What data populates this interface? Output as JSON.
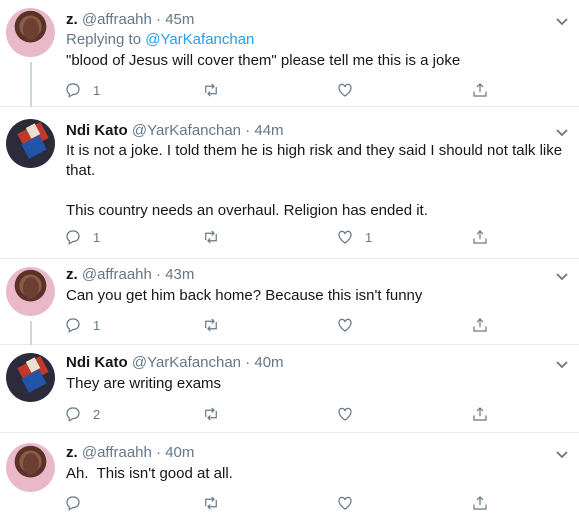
{
  "tweets": [
    {
      "name": "z.",
      "handle": "@affraahh",
      "dot": "·",
      "time": "45m",
      "replying_prefix": "Replying to",
      "replying_to": "@YarKafanchan",
      "text": [
        "\"blood of Jesus will cover them\" please tell me this is a joke"
      ],
      "replies": "1",
      "retweets": "",
      "likes": "",
      "avatar_icon": "profile-photo-z"
    },
    {
      "name": "Ndi Kato",
      "handle": "@YarKafanchan",
      "dot": "·",
      "time": "44m",
      "text": [
        "It is not a joke. I told them he is high risk and they said I should not talk like that.",
        "This country needs an overhaul. Religion has ended it."
      ],
      "replies": "1",
      "retweets": "",
      "likes": "1",
      "avatar_icon": "profile-photo-ndi-kato"
    },
    {
      "name": "z.",
      "handle": "@affraahh",
      "dot": "·",
      "time": "43m",
      "text": [
        "Can you get him back home? Because this isn't funny"
      ],
      "replies": "1",
      "retweets": "",
      "likes": "",
      "avatar_icon": "profile-photo-z"
    },
    {
      "name": "Ndi Kato",
      "handle": "@YarKafanchan",
      "dot": "·",
      "time": "40m",
      "text": [
        "They are writing exams"
      ],
      "replies": "2",
      "retweets": "",
      "likes": "",
      "avatar_icon": "profile-photo-ndi-kato"
    },
    {
      "name": "z.",
      "handle": "@affraahh",
      "dot": "·",
      "time": "40m",
      "text": [
        "Ah.  This isn't good at all."
      ],
      "replies": "",
      "retweets": "",
      "likes": "",
      "avatar_icon": "profile-photo-z"
    }
  ],
  "colors": {
    "link": "#1da1f2",
    "secondary_text": "#657786",
    "primary_text": "#14171a",
    "divider": "#e6ecf0"
  },
  "icons": [
    "reply-icon",
    "retweet-icon",
    "like-icon",
    "share-icon",
    "chevron-down-icon"
  ]
}
